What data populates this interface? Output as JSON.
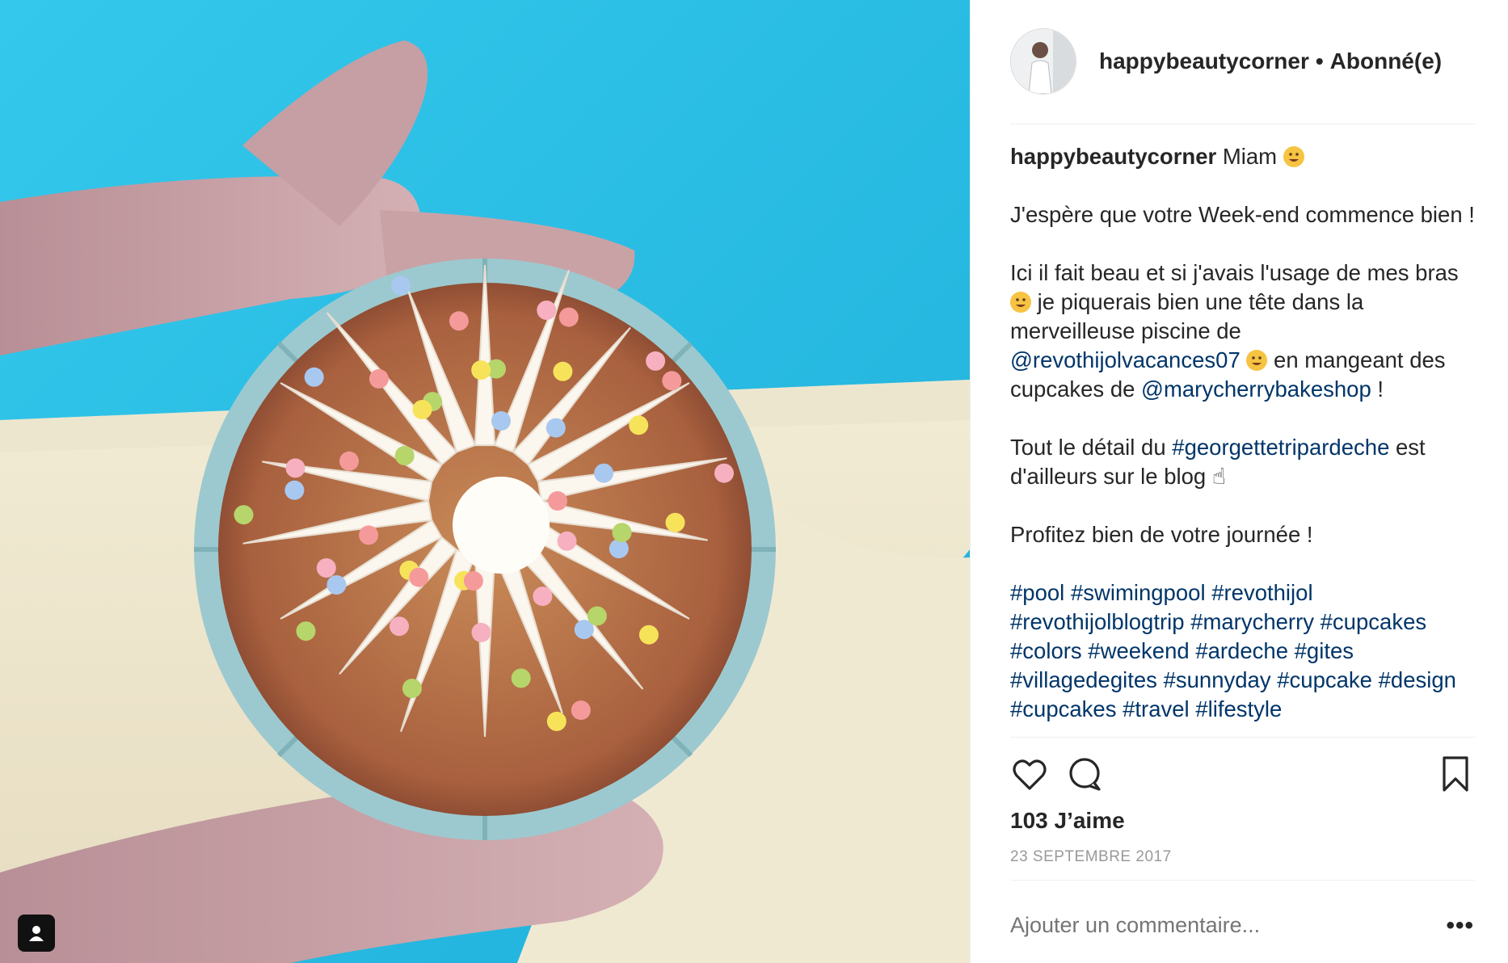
{
  "colors": {
    "link": "#003569",
    "muted": "#999999",
    "border": "#efefef",
    "pool": "#2fc4e6"
  },
  "header": {
    "username": "happybeautycorner",
    "separator": "•",
    "follow_status": "Abonné(e)"
  },
  "caption": {
    "username": "happybeautycorner",
    "line1_text": " Miam ",
    "p2": "J'espère que votre Week-end commence bien !",
    "p3_a": "Ici il fait beau et si j'avais l'usage de mes bras ",
    "p3_b": " je piquerais bien une tête dans la merveilleuse piscine de ",
    "p3_mention1": "@revothijolvacances07",
    "p3_c": " en mangeant des cupcakes de ",
    "p3_mention2": "@marycherrybakeshop",
    "p3_d": " !",
    "p4_a": "Tout le détail du ",
    "p4_tag": "#georgettetripardeche",
    "p4_b": " est d'ailleurs sur le blog ",
    "p5": "Profitez bien de votre journée !",
    "hashtags": [
      "#pool",
      "#swimingpool",
      "#revothijol",
      "#revothijolblogtrip",
      "#marycherry",
      "#cupcakes",
      "#colors",
      "#weekend",
      "#ardeche",
      "#gites",
      "#villagedegites",
      "#sunnyday",
      "#cupcake",
      "#design",
      "#cupcakes",
      "#travel",
      "#lifestyle"
    ]
  },
  "icons": {
    "like": "heart-icon",
    "comment": "speech-bubble-icon",
    "save": "bookmark-icon",
    "tag": "person-tag-icon",
    "more": "more-options-icon"
  },
  "likes_text": "103 J’aime",
  "date_text": "23 SEPTEMBRE 2017",
  "comment_placeholder": "Ajouter un commentaire...",
  "more_label": "•••"
}
